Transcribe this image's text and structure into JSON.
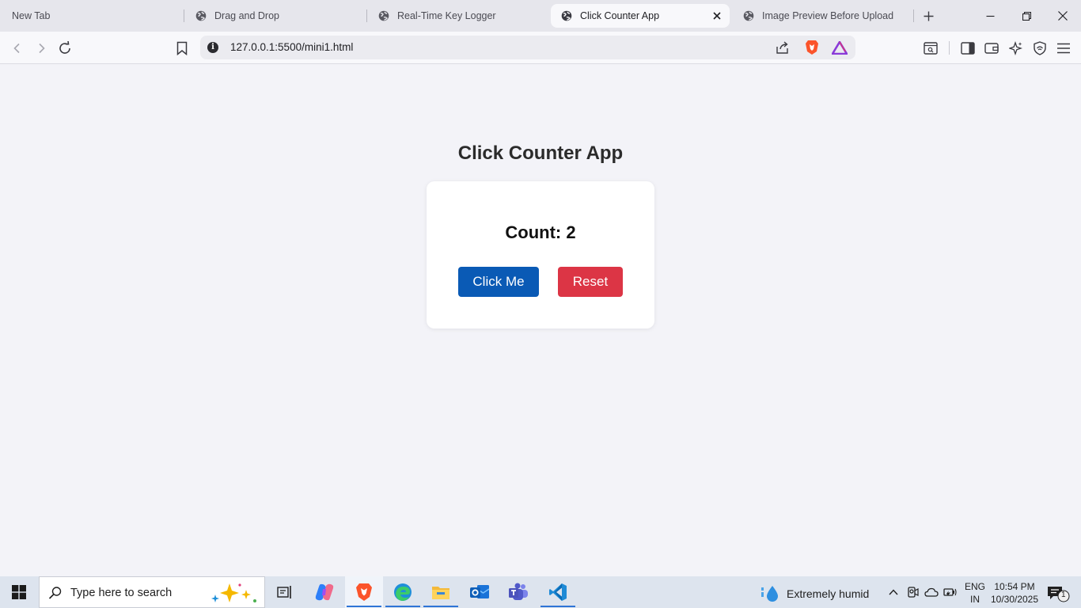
{
  "browser": {
    "tabs": [
      {
        "label": "New Tab"
      },
      {
        "label": "Drag and Drop"
      },
      {
        "label": "Real-Time Key Logger"
      },
      {
        "label": "Click Counter App"
      },
      {
        "label": "Image Preview Before Upload"
      }
    ],
    "active_tab": 3,
    "url": "127.0.0.1:5500/mini1.html"
  },
  "page": {
    "title": "Click Counter App",
    "count_text": "Count: 2",
    "click_button": "Click Me",
    "reset_button": "Reset",
    "colors": {
      "click_button": "#0a5ab5",
      "reset_button": "#dc3545",
      "background": "#f3f3f8"
    }
  },
  "taskbar": {
    "search_placeholder": "Type here to search",
    "weather": "Extremely humid",
    "language_line1": "ENG",
    "language_line2": "IN",
    "time": "10:54 PM",
    "date": "10/30/2025",
    "notification_count": "1",
    "pinned_apps": [
      "task-view",
      "copilot",
      "brave",
      "edge",
      "file-explorer",
      "outlook",
      "teams",
      "vscode"
    ]
  }
}
